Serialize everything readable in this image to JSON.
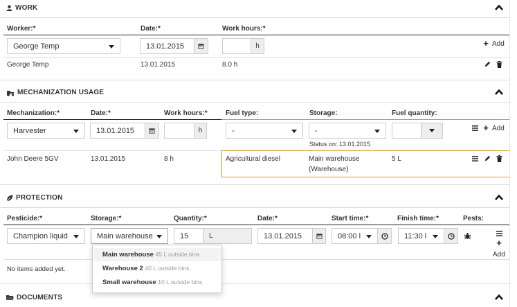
{
  "work": {
    "title": "WORK",
    "labels": {
      "worker": "Worker:*",
      "date": "Date:*",
      "hours": "Work hours:*"
    },
    "form": {
      "worker": "George Temp",
      "date": "13.01.2015",
      "hours": "",
      "hours_unit": "h"
    },
    "add_label": "Add",
    "row": {
      "worker": "George Temp",
      "date": "13.01.2015",
      "hours": "8.0 h"
    }
  },
  "mech": {
    "title": "MECHANIZATION USAGE",
    "labels": {
      "mechanization": "Mechanization:*",
      "date": "Date:*",
      "hours": "Work hours:*",
      "fuel_type": "Fuel type:",
      "storage": "Storage:",
      "fuel_qty": "Fuel quantity:"
    },
    "form": {
      "mechanization": "Harvester",
      "date": "13.01.2015",
      "hours": "",
      "hours_unit": "h",
      "fuel_type": "-",
      "storage": "-",
      "fuel_qty": "",
      "status": "Status on: 13.01.2015"
    },
    "add_label": "Add",
    "row": {
      "mechanization": "John Deere 5GV",
      "date": "13.01.2015",
      "hours": "8 h",
      "fuel_type": "Agricultural diesel",
      "storage_line1": "Main warehouse",
      "storage_line2": "(Warehouse)",
      "fuel_qty": "5 L"
    }
  },
  "protection": {
    "title": "PROTECTION",
    "labels": {
      "pesticide": "Pesticide:*",
      "storage": "Storage:*",
      "quantity": "Quantity:*",
      "date": "Date:*",
      "start": "Start time:*",
      "finish": "Finish time:*",
      "pests": "Pests:"
    },
    "form": {
      "pesticide": "Champion liquid",
      "storage": "Main warehouse",
      "quantity": "15",
      "unit": "L",
      "date": "13.01.2015",
      "start": "08:00 l",
      "finish": "11:30 l"
    },
    "add_label": "Add",
    "empty": "No items added yet.",
    "dropdown": [
      {
        "name": "Main warehouse",
        "detail": "45 L outside bins"
      },
      {
        "name": "Warehouse 2",
        "detail": "40 L outside bins"
      },
      {
        "name": "Small warehouse",
        "detail": "10 L outside bins"
      }
    ]
  },
  "documents": {
    "title": "DOCUMENTS"
  }
}
